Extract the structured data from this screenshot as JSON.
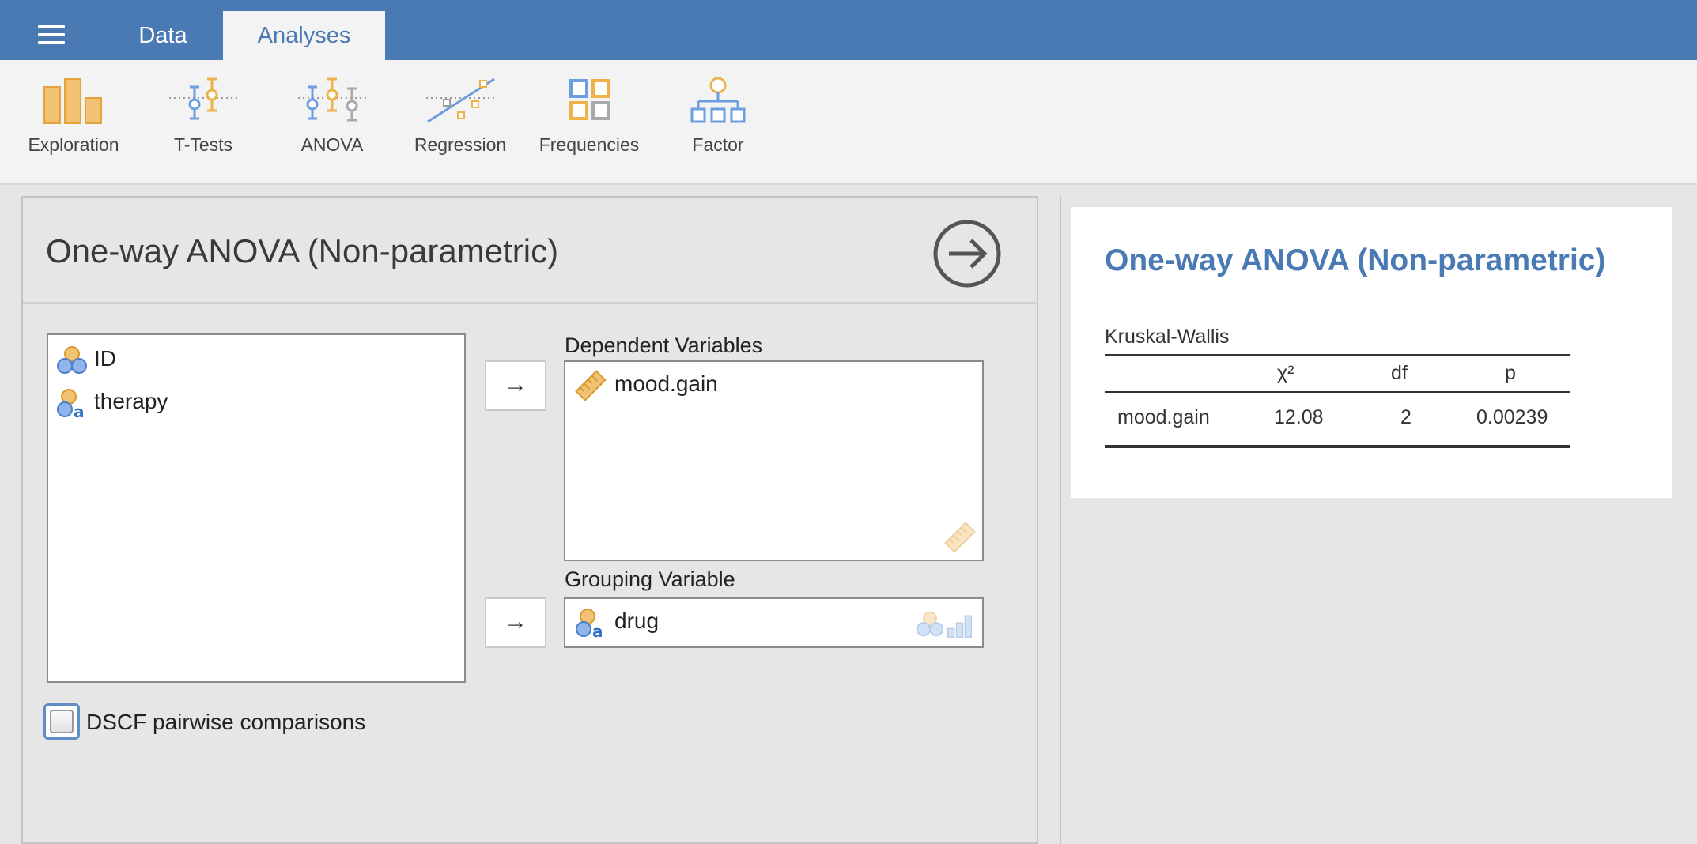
{
  "tabs": [
    {
      "label": "Data"
    },
    {
      "label": "Analyses"
    }
  ],
  "ribbon": [
    {
      "label": "Exploration",
      "icon": "exploration-icon"
    },
    {
      "label": "T-Tests",
      "icon": "t-tests-icon"
    },
    {
      "label": "ANOVA",
      "icon": "anova-icon"
    },
    {
      "label": "Regression",
      "icon": "regression-icon"
    },
    {
      "label": "Frequencies",
      "icon": "frequencies-icon"
    },
    {
      "label": "Factor",
      "icon": "factor-icon"
    }
  ],
  "options": {
    "title": "One-way ANOVA (Non-parametric)",
    "available_variables": [
      {
        "name": "ID",
        "type": "nominal"
      },
      {
        "name": "therapy",
        "type": "nominal-text"
      }
    ],
    "dependent_label": "Dependent Variables",
    "dependent_variables": [
      {
        "name": "mood.gain",
        "type": "continuous"
      }
    ],
    "grouping_label": "Grouping Variable",
    "grouping_variable": {
      "name": "drug",
      "type": "nominal-text"
    },
    "dscf_label": "DSCF pairwise comparisons",
    "dscf_checked": false
  },
  "results": {
    "title": "One-way ANOVA (Non-parametric)",
    "table_title": "Kruskal-Wallis",
    "columns": [
      "",
      "χ²",
      "df",
      "p"
    ],
    "rows": [
      {
        "name": "mood.gain",
        "chi2": "12.08",
        "df": "2",
        "p": "0.00239"
      }
    ]
  },
  "colors": {
    "topbar": "#4a7ab3",
    "accent_blue": "#6d9ee0",
    "accent_orange": "#efb24b",
    "accent_gray": "#a9a9a9"
  }
}
